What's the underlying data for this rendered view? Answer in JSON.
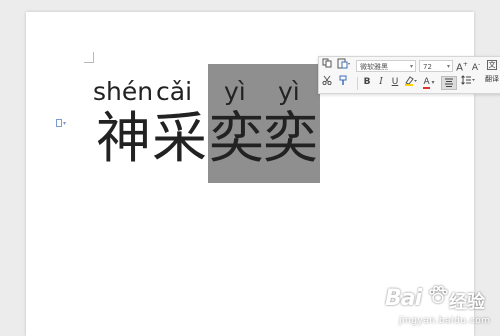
{
  "document": {
    "pinyin": [
      "shén",
      "cǎi",
      "yì",
      "yì"
    ],
    "characters": [
      "神",
      "采",
      "奕",
      "奕"
    ]
  },
  "toolbar": {
    "font_name": "微软雅黑",
    "font_size": "72",
    "bold": "B",
    "italic": "I",
    "underline": "U",
    "font_color": "A",
    "grow_font": "A",
    "shrink_font": "A",
    "more_label": "翻译"
  },
  "watermark": {
    "logo": "Bai",
    "brand_cn": "经验",
    "url": "jingyan.baidu.com"
  },
  "colors": {
    "selection": "#8f8f8f",
    "paragraph_mark": "#7b9ad1",
    "background": "#ececec"
  }
}
